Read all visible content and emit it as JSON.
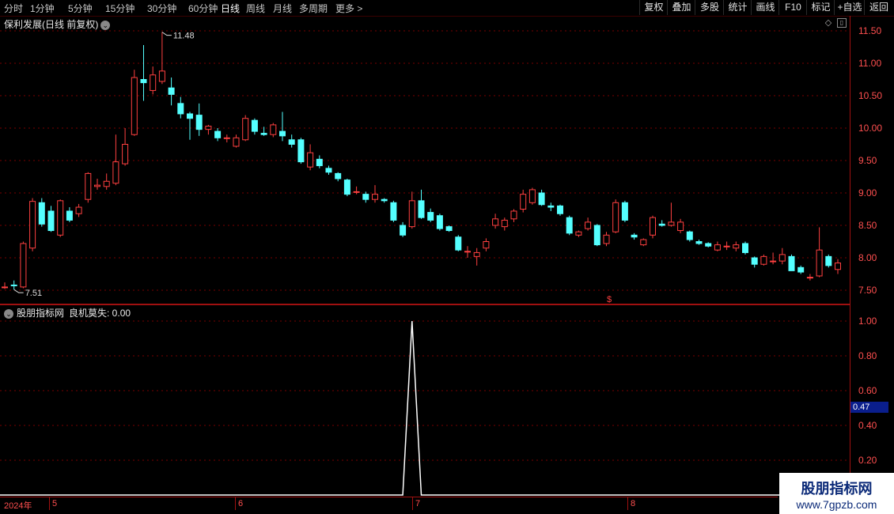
{
  "toolbar": {
    "periods": [
      "分时",
      "1分钟",
      "5分钟",
      "15分钟",
      "30分钟",
      "60分钟",
      "日线",
      "周线",
      "月线",
      "多周期",
      "更多"
    ],
    "active_period": "日线",
    "right_buttons": [
      "复权",
      "叠加",
      "多股",
      "统计",
      "画线",
      "F10",
      "标记",
      "+自选",
      "返回"
    ]
  },
  "stock": {
    "title": "保利发展(日线 前复权)"
  },
  "price_axis": {
    "labels": [
      "11.50",
      "11.00",
      "10.50",
      "10.00",
      "9.50",
      "9.00",
      "8.50",
      "8.00",
      "7.50"
    ]
  },
  "annotations": {
    "high": "11.48",
    "low": "7.51",
    "marker": "$"
  },
  "indicator": {
    "name": "股朋指标网",
    "line": "良机莫失: 0.00",
    "axis_labels": [
      "1.00",
      "0.80",
      "0.60",
      "0.40",
      "0.20"
    ],
    "highlight": "0.47"
  },
  "date_axis": {
    "year": "2024年",
    "months": [
      "5",
      "6",
      "7",
      "8"
    ]
  },
  "watermark": {
    "line1": "股朋指标网",
    "line2": "www.7gpzb.com"
  },
  "colors": {
    "up": "#ff4040",
    "down": "#54ffff",
    "axis": "#a01010",
    "grid": "#7a0000"
  },
  "chart_data": [
    {
      "type": "candlestick",
      "title": "保利发展(日线 前复权)",
      "ylim": [
        7.3,
        11.6
      ],
      "candles": [
        {
          "o": 7.55,
          "h": 7.62,
          "l": 7.52,
          "c": 7.55
        },
        {
          "o": 7.58,
          "h": 7.65,
          "l": 7.51,
          "c": 7.57
        },
        {
          "o": 7.55,
          "h": 8.25,
          "l": 7.53,
          "c": 8.22
        },
        {
          "o": 8.15,
          "h": 8.92,
          "l": 8.1,
          "c": 8.87
        },
        {
          "o": 8.85,
          "h": 8.92,
          "l": 8.48,
          "c": 8.52
        },
        {
          "o": 8.72,
          "h": 8.8,
          "l": 8.4,
          "c": 8.42
        },
        {
          "o": 8.35,
          "h": 8.9,
          "l": 8.32,
          "c": 8.88
        },
        {
          "o": 8.72,
          "h": 8.78,
          "l": 8.55,
          "c": 8.58
        },
        {
          "o": 8.68,
          "h": 8.83,
          "l": 8.63,
          "c": 8.78
        },
        {
          "o": 8.9,
          "h": 9.32,
          "l": 8.85,
          "c": 9.3
        },
        {
          "o": 9.1,
          "h": 9.22,
          "l": 9.05,
          "c": 9.12
        },
        {
          "o": 9.1,
          "h": 9.3,
          "l": 9.05,
          "c": 9.18
        },
        {
          "o": 9.15,
          "h": 9.9,
          "l": 9.12,
          "c": 9.48
        },
        {
          "o": 9.45,
          "h": 10.0,
          "l": 9.42,
          "c": 9.75
        },
        {
          "o": 9.9,
          "h": 10.9,
          "l": 9.88,
          "c": 10.78
        },
        {
          "o": 10.75,
          "h": 11.28,
          "l": 10.42,
          "c": 10.7
        },
        {
          "o": 10.58,
          "h": 10.95,
          "l": 10.52,
          "c": 10.82
        },
        {
          "o": 10.72,
          "h": 11.48,
          "l": 10.68,
          "c": 10.88
        },
        {
          "o": 10.62,
          "h": 10.78,
          "l": 10.35,
          "c": 10.52
        },
        {
          "o": 10.38,
          "h": 10.48,
          "l": 10.15,
          "c": 10.22
        },
        {
          "o": 10.22,
          "h": 10.25,
          "l": 9.82,
          "c": 10.15
        },
        {
          "o": 10.2,
          "h": 10.38,
          "l": 9.88,
          "c": 9.98
        },
        {
          "o": 9.98,
          "h": 10.05,
          "l": 9.9,
          "c": 10.03
        },
        {
          "o": 9.95,
          "h": 10.0,
          "l": 9.8,
          "c": 9.85
        },
        {
          "o": 9.85,
          "h": 9.9,
          "l": 9.78,
          "c": 9.85
        },
        {
          "o": 9.72,
          "h": 9.9,
          "l": 9.7,
          "c": 9.85
        },
        {
          "o": 9.82,
          "h": 10.2,
          "l": 9.8,
          "c": 10.15
        },
        {
          "o": 10.12,
          "h": 10.15,
          "l": 9.9,
          "c": 9.95
        },
        {
          "o": 9.92,
          "h": 10.02,
          "l": 9.88,
          "c": 9.9
        },
        {
          "o": 9.9,
          "h": 10.08,
          "l": 9.86,
          "c": 10.05
        },
        {
          "o": 9.95,
          "h": 10.25,
          "l": 9.8,
          "c": 9.88
        },
        {
          "o": 9.82,
          "h": 9.9,
          "l": 9.7,
          "c": 9.75
        },
        {
          "o": 9.82,
          "h": 9.85,
          "l": 9.45,
          "c": 9.48
        },
        {
          "o": 9.4,
          "h": 9.75,
          "l": 9.35,
          "c": 9.62
        },
        {
          "o": 9.52,
          "h": 9.58,
          "l": 9.38,
          "c": 9.42
        },
        {
          "o": 9.38,
          "h": 9.42,
          "l": 9.28,
          "c": 9.32
        },
        {
          "o": 9.3,
          "h": 9.32,
          "l": 9.18,
          "c": 9.22
        },
        {
          "o": 9.2,
          "h": 9.22,
          "l": 8.95,
          "c": 8.98
        },
        {
          "o": 9.02,
          "h": 9.1,
          "l": 8.98,
          "c": 9.02
        },
        {
          "o": 8.98,
          "h": 9.02,
          "l": 8.85,
          "c": 8.9
        },
        {
          "o": 8.9,
          "h": 9.12,
          "l": 8.85,
          "c": 8.98
        },
        {
          "o": 8.9,
          "h": 8.92,
          "l": 8.85,
          "c": 8.88
        },
        {
          "o": 8.85,
          "h": 8.88,
          "l": 8.55,
          "c": 8.58
        },
        {
          "o": 8.5,
          "h": 8.55,
          "l": 8.32,
          "c": 8.35
        },
        {
          "o": 8.48,
          "h": 9.02,
          "l": 8.45,
          "c": 8.88
        },
        {
          "o": 8.88,
          "h": 9.05,
          "l": 8.6,
          "c": 8.62
        },
        {
          "o": 8.7,
          "h": 8.76,
          "l": 8.55,
          "c": 8.58
        },
        {
          "o": 8.65,
          "h": 8.68,
          "l": 8.42,
          "c": 8.45
        },
        {
          "o": 8.48,
          "h": 8.5,
          "l": 8.4,
          "c": 8.42
        },
        {
          "o": 8.32,
          "h": 8.35,
          "l": 8.1,
          "c": 8.12
        },
        {
          "o": 8.1,
          "h": 8.18,
          "l": 8.0,
          "c": 8.1
        },
        {
          "o": 8.02,
          "h": 8.15,
          "l": 7.88,
          "c": 8.08
        },
        {
          "o": 8.15,
          "h": 8.3,
          "l": 8.1,
          "c": 8.25
        },
        {
          "o": 8.5,
          "h": 8.68,
          "l": 8.45,
          "c": 8.6
        },
        {
          "o": 8.48,
          "h": 8.62,
          "l": 8.42,
          "c": 8.58
        },
        {
          "o": 8.6,
          "h": 8.75,
          "l": 8.55,
          "c": 8.72
        },
        {
          "o": 8.75,
          "h": 9.05,
          "l": 8.7,
          "c": 8.98
        },
        {
          "o": 8.85,
          "h": 9.08,
          "l": 8.82,
          "c": 9.05
        },
        {
          "o": 9.0,
          "h": 9.05,
          "l": 8.8,
          "c": 8.82
        },
        {
          "o": 8.8,
          "h": 8.85,
          "l": 8.72,
          "c": 8.78
        },
        {
          "o": 8.8,
          "h": 8.82,
          "l": 8.65,
          "c": 8.68
        },
        {
          "o": 8.62,
          "h": 8.65,
          "l": 8.35,
          "c": 8.38
        },
        {
          "o": 8.35,
          "h": 8.42,
          "l": 8.32,
          "c": 8.4
        },
        {
          "o": 8.45,
          "h": 8.62,
          "l": 8.42,
          "c": 8.55
        },
        {
          "o": 8.5,
          "h": 8.52,
          "l": 8.18,
          "c": 8.2
        },
        {
          "o": 8.22,
          "h": 8.4,
          "l": 8.18,
          "c": 8.35
        },
        {
          "o": 8.4,
          "h": 8.9,
          "l": 8.38,
          "c": 8.85
        },
        {
          "o": 8.85,
          "h": 8.88,
          "l": 8.55,
          "c": 8.58
        },
        {
          "o": 8.35,
          "h": 8.38,
          "l": 8.28,
          "c": 8.32
        },
        {
          "o": 8.2,
          "h": 8.3,
          "l": 8.18,
          "c": 8.28
        },
        {
          "o": 8.35,
          "h": 8.65,
          "l": 8.3,
          "c": 8.62
        },
        {
          "o": 8.52,
          "h": 8.58,
          "l": 8.48,
          "c": 8.5
        },
        {
          "o": 8.5,
          "h": 8.85,
          "l": 8.48,
          "c": 8.55
        },
        {
          "o": 8.42,
          "h": 8.6,
          "l": 8.38,
          "c": 8.55
        },
        {
          "o": 8.4,
          "h": 8.42,
          "l": 8.25,
          "c": 8.28
        },
        {
          "o": 8.25,
          "h": 8.28,
          "l": 8.2,
          "c": 8.22
        },
        {
          "o": 8.22,
          "h": 8.24,
          "l": 8.16,
          "c": 8.18
        },
        {
          "o": 8.12,
          "h": 8.25,
          "l": 8.1,
          "c": 8.2
        },
        {
          "o": 8.18,
          "h": 8.25,
          "l": 8.12,
          "c": 8.18
        },
        {
          "o": 8.15,
          "h": 8.25,
          "l": 8.1,
          "c": 8.2
        },
        {
          "o": 8.22,
          "h": 8.25,
          "l": 8.05,
          "c": 8.08
        },
        {
          "o": 8.0,
          "h": 8.02,
          "l": 7.85,
          "c": 7.9
        },
        {
          "o": 7.9,
          "h": 8.05,
          "l": 7.88,
          "c": 8.02
        },
        {
          "o": 7.95,
          "h": 8.08,
          "l": 7.9,
          "c": 7.95
        },
        {
          "o": 7.95,
          "h": 8.15,
          "l": 7.9,
          "c": 8.05
        },
        {
          "o": 8.02,
          "h": 8.05,
          "l": 7.85,
          "c": 7.8
        },
        {
          "o": 7.85,
          "h": 7.88,
          "l": 7.75,
          "c": 7.78
        },
        {
          "o": 7.7,
          "h": 7.75,
          "l": 7.65,
          "c": 7.7
        },
        {
          "o": 7.72,
          "h": 8.47,
          "l": 7.7,
          "c": 8.12
        },
        {
          "o": 8.02,
          "h": 8.05,
          "l": 7.85,
          "c": 7.88
        },
        {
          "o": 7.82,
          "h": 7.98,
          "l": 7.75,
          "c": 7.92
        }
      ]
    },
    {
      "type": "line",
      "title": "股朋指标网",
      "series": [
        {
          "name": "良机莫失",
          "peak_index": 44,
          "values_note": "0 everywhere except 1.00 spike"
        }
      ],
      "ylim": [
        0,
        1.0
      ]
    }
  ]
}
